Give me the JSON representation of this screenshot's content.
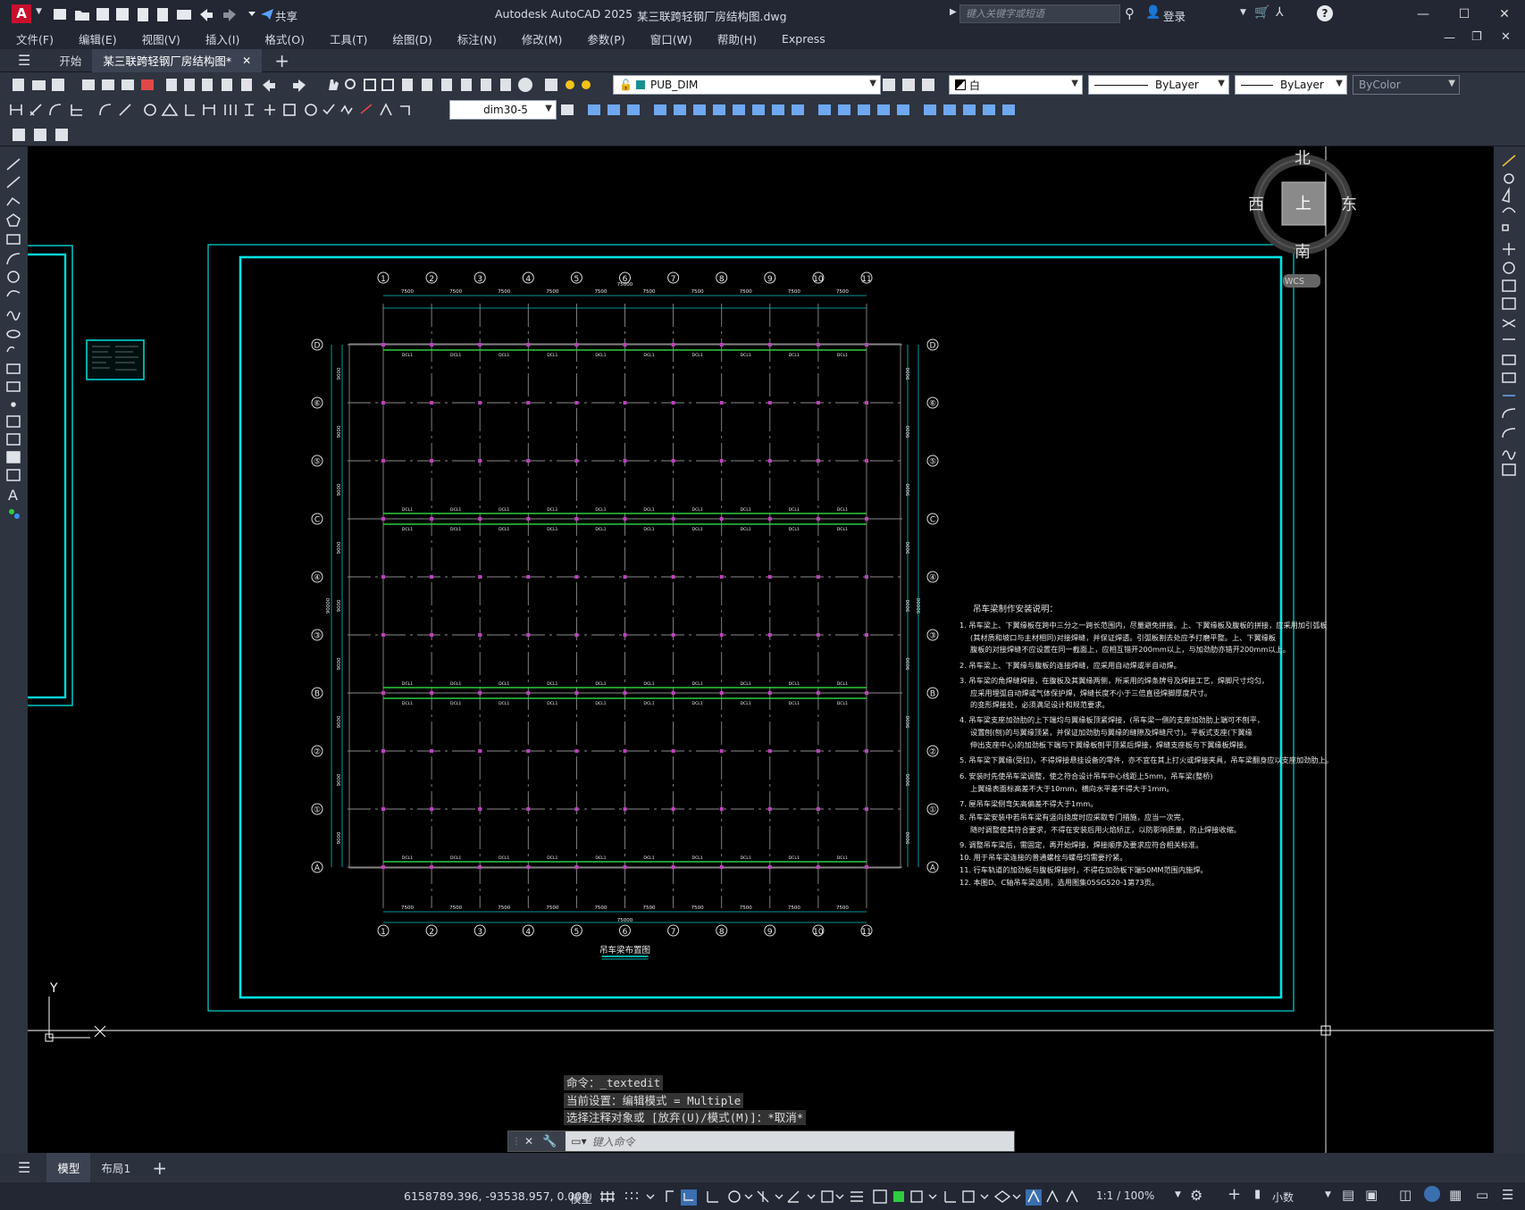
{
  "app": {
    "title": "Autodesk AutoCAD 2025",
    "filename": "某三联跨轻钢厂房结构图.dwg",
    "share_label": "共享",
    "search_placeholder": "键入关键字或短语",
    "login_label": "登录"
  },
  "menu": [
    "文件(F)",
    "编辑(E)",
    "视图(V)",
    "插入(I)",
    "格式(O)",
    "工具(T)",
    "绘图(D)",
    "标注(N)",
    "修改(M)",
    "参数(P)",
    "窗口(W)",
    "帮助(H)",
    "Express"
  ],
  "tabs": {
    "start": "开始",
    "drawing": "某三联跨轻钢厂房结构图*"
  },
  "toolbar": {
    "layer": "PUB_DIM",
    "color": "白",
    "linetype": "ByLayer",
    "lineweight": "ByLayer",
    "plotstyle": "ByColor",
    "dimstyle": "dim30-5"
  },
  "viewcube": {
    "north": "北",
    "south": "南",
    "east": "东",
    "west": "西",
    "top": "上",
    "wcs": "WCS"
  },
  "ucs": {
    "y": "Y",
    "x": "X"
  },
  "drawing": {
    "columns": [
      "1",
      "2",
      "3",
      "4",
      "5",
      "6",
      "7",
      "8",
      "9",
      "10",
      "11"
    ],
    "rows": [
      "D",
      "⑥",
      "⑤",
      "C",
      "④",
      "③",
      "B",
      "②",
      "①",
      "A"
    ],
    "bay": "7500",
    "total_width": "75000",
    "row_spacings": [
      "9000",
      "9000",
      "9000",
      "9000",
      "9000",
      "9000",
      "9000",
      "9000",
      "9000"
    ],
    "total_height": "90000",
    "beam_label": "DCL1",
    "title": "吊车梁布置图"
  },
  "notes": {
    "heading": "吊车梁制作安装说明：",
    "lines": [
      "1. 吊车梁上、下翼缘板在跨中三分之一跨长范围内，尽量避免拼接。上、下翼缘板及腹板的拼接，应采用加引弧板",
      "(其材质和坡口与主材相同)对接焊缝，并保证焊透。引弧板割去处应予打磨平整。上、下翼缘板",
      "腹板的对接焊缝不应设置在同一截面上，应相互错开200mm以上，与加劲肋亦错开200mm以上。",
      "2. 吊车梁上、下翼缘与腹板的连接焊缝，应采用自动焊或半自动焊。",
      "3. 吊车梁的角焊缝焊接，在腹板及其翼缘两侧，所采用的焊条牌号及焊接工艺，焊脚尺寸均匀，",
      "应采用埋弧自动焊或气体保护焊，焊缝长度不小于三倍直径焊脚厚度尺寸。",
      "的变形焊接处，必须满足设计和规范要求。",
      "4. 吊车梁支座加劲肋的上下端均与翼缘板顶紧焊接，(吊车梁一侧的支座加劲肋上端可不刨平，",
      "设置刨(刨)的与翼缘顶紧，并保证加劲肋与翼缘的缝隙及焊缝尺寸)。平板式支座(下翼缘",
      "伸出支座中心)的加劲板下端与下翼缘板刨平顶紧后焊接，焊缝支座板与下翼缘板焊接。",
      "5. 吊车梁下翼缘(受拉)，不得焊接悬挂设备的零件，亦不宜在其上打火或焊接夹具，吊车梁翻身应以支座加劲肋上。",
      "6. 安装时先使吊车梁调整，使之符合设计吊车中心线距上5mm，吊车梁(整桥)",
      "上翼缘表面标高差不大于10mm，横向水平差不得大于1mm。",
      "7. 屋吊车梁侧弯矢高偏差不得大于1mm。",
      "8. 吊车梁安装中若吊车梁有竖向挠度时应采取专门措施，应当一次完，",
      "随时调整使其符合要求，不得在安装后用火焰矫正，以防影响质量，防止焊接收缩。",
      "9. 调整吊车梁后，需固定，再开始焊接，焊接顺序及要求应符合相关标准。",
      "10. 用于吊车梁连接的普通螺栓与螺母均需要拧紧。",
      "11. 行车轨道的加劲板与腹板焊接时，不得在加劲板下端50MM范围内施焊。",
      "12. 本图D、C轴吊车梁选用，选用图集05SG520-1第73页。"
    ]
  },
  "command": {
    "line1": "命令：_textedit",
    "line2": "当前设置：编辑模式 = Multiple",
    "line3": "选择注释对象或 [放弃(U)/模式(M)]：*取消*",
    "placeholder": "键入命令"
  },
  "layout_tabs": [
    "模型",
    "布局1"
  ],
  "status": {
    "coords": "6158789.396, -93538.957, 0.000",
    "model": "模型",
    "scale": "1:1 / 100%",
    "units": "小数"
  },
  "colors": {
    "cyan": "#00e5e5",
    "green": "#2ecc40",
    "magenta": "#c040c0",
    "canvas": "#000000",
    "panel": "#2e3440"
  }
}
